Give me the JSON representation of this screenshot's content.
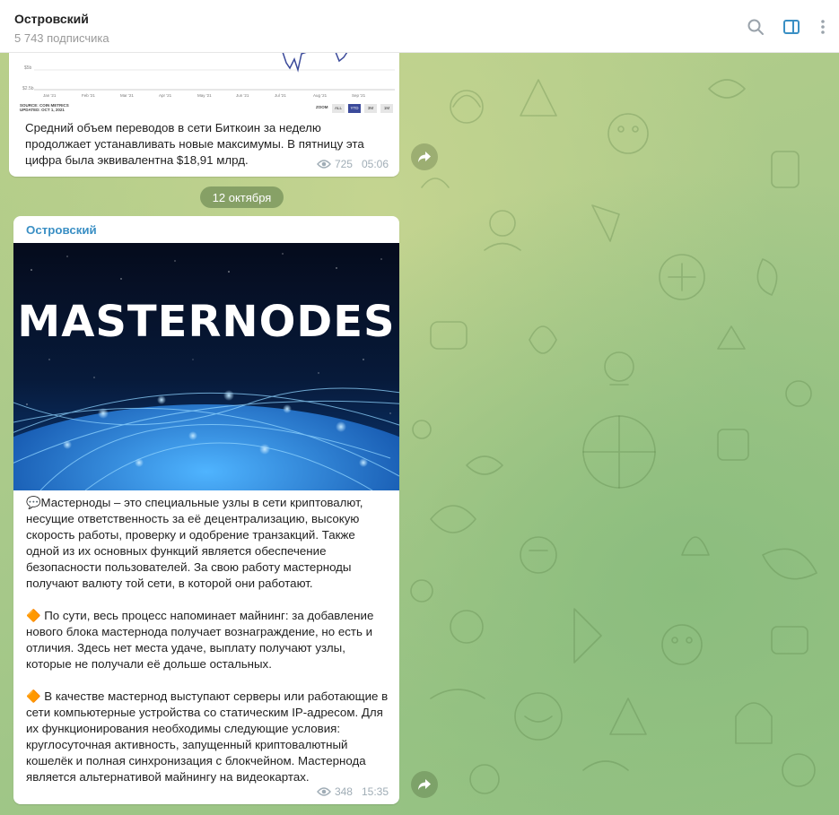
{
  "header": {
    "title": "Островский",
    "subscribers": "5 743 подписчика"
  },
  "chart_preview": {
    "ylabels": [
      "$5b",
      "$2.5b"
    ],
    "xlabels": [
      "Jan '21",
      "Feb '21",
      "Mar '21",
      "Apr '21",
      "May '21",
      "Jun '21",
      "Jul '21",
      "Aug '21",
      "Sep '21"
    ],
    "source_line1": "SOURCE: COIN METRICS",
    "source_line2": "UPDATED: OCT 1, 2021",
    "zoom_label": "ZOOM",
    "zoom_buttons": [
      "ALL",
      "YTD",
      "3M",
      "1M"
    ],
    "zoom_active": "YTD"
  },
  "message1": {
    "text": "Средний объем переводов в сети Биткоин за неделю продолжает устанавливать новые максимумы. В пятницу эта цифра была эквивалентна $18,91 млрд.",
    "views": "725",
    "time": "05:06"
  },
  "date_separator": "12 октября",
  "message2": {
    "sender": "Островский",
    "image_caption": "MASTERNODES",
    "paragraph1": "💬Мастерноды – это специальные узлы в сети криптовалют, несущие ответственность за её децентрализацию, высокую скорость работы, проверку и одобрение транзакций. Также одной из их основных функций является обеспечение безопасности пользователей. За свою работу мастерноды получают валюту той сети, в которой они работают.",
    "paragraph2": "🔶 По сути, весь процесс напоминает майнинг: за добавление нового блока мастернода получает вознаграждение, но есть и отличия. Здесь нет места удаче, выплату получают узлы, которые не получали её дольше остальных.",
    "paragraph3": "🔶 В качестве мастернод выступают серверы или работающие в сети компьютерные устройства со статическим IP-адресом. Для их функционирования необходимы следующие условия: круглосуточная активность, запущенный криптовалютный кошелёк и полная синхронизация с блокчейном. Мастернода является альтернативой майнингу на видеокартах.",
    "views": "348",
    "time": "15:35"
  },
  "colors": {
    "sender": "#3a8fc4",
    "meta": "#a0adb6",
    "sidebar_icon_active": "#3a8fc4"
  },
  "icons": {
    "search": "search-icon",
    "sidebar": "sidebar-toggle-icon",
    "more": "more-vertical-icon",
    "eye": "eye-icon",
    "share": "share-icon"
  }
}
